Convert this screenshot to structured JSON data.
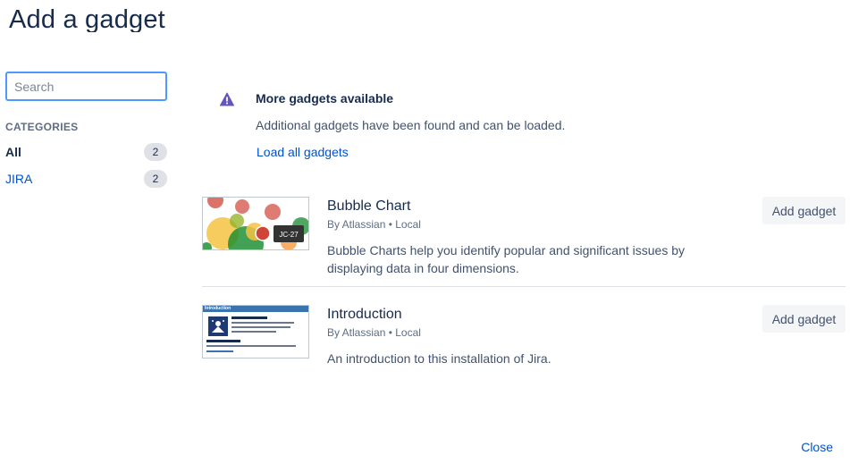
{
  "dialog": {
    "title": "Add a gadget",
    "close_label": "Close"
  },
  "sidebar": {
    "search_placeholder": "Search",
    "categories_heading": "CATEGORIES",
    "categories": [
      {
        "label": "All",
        "count": "2",
        "active": true
      },
      {
        "label": "JIRA",
        "count": "2",
        "active": false
      }
    ]
  },
  "notice": {
    "icon": "warning-icon",
    "title": "More gadgets available",
    "text": "Additional gadgets have been found and can be loaded.",
    "link": "Load all gadgets"
  },
  "gadgets": [
    {
      "title": "Bubble Chart",
      "meta": "By Atlassian • Local",
      "description": "Bubble Charts help you identify popular and significant issues by displaying data in four dimensions.",
      "button": "Add gadget",
      "thumb_label": "JC-27"
    },
    {
      "title": "Introduction",
      "meta": "By Atlassian • Local",
      "description": "An introduction to this installation of Jira.",
      "button": "Add gadget",
      "thumb_header": "Introduction"
    }
  ],
  "colors": {
    "link": "#0052cc",
    "text": "#172b4d",
    "warning": "#6554c0",
    "focus": "#4c9aff"
  }
}
